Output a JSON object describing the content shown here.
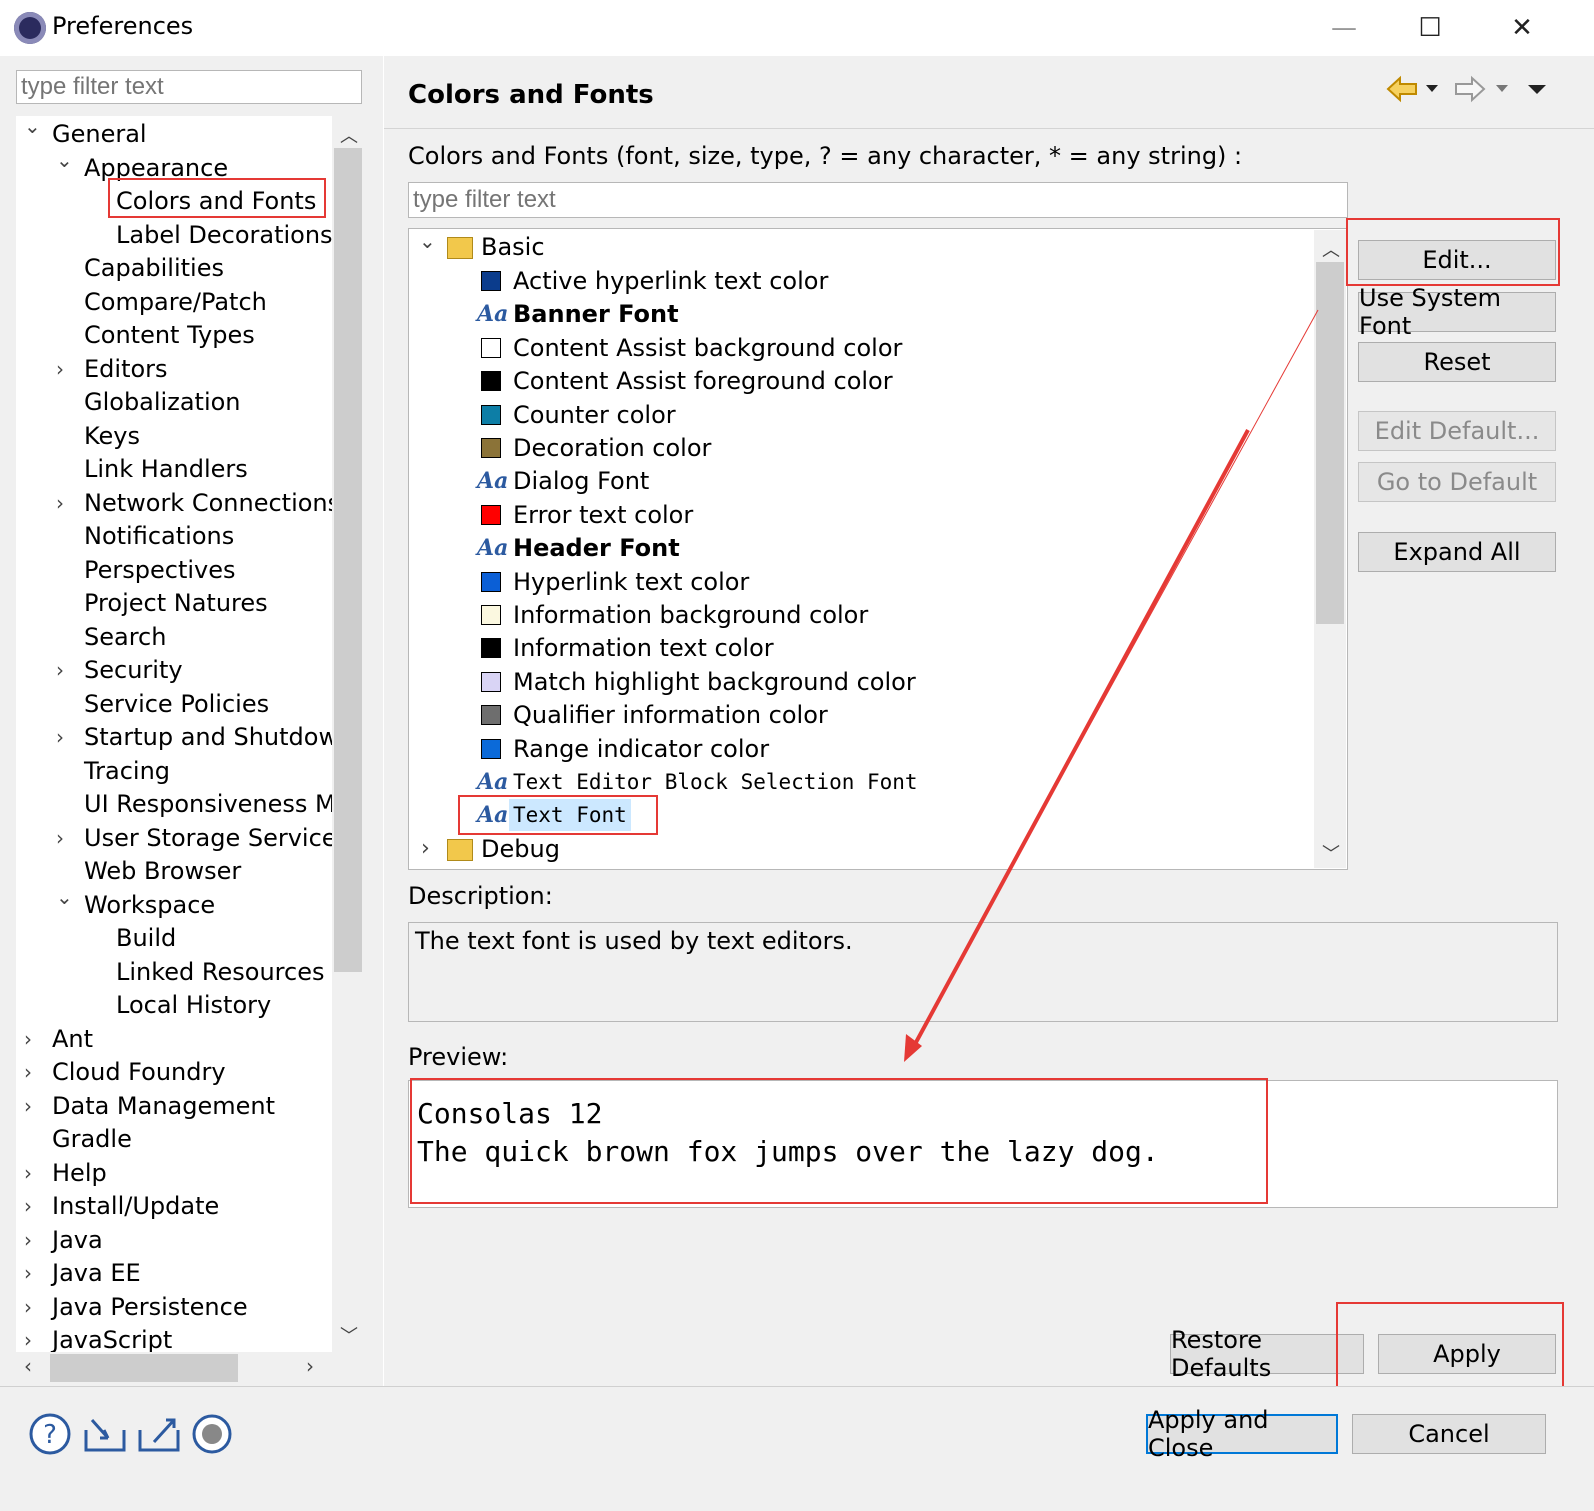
{
  "window": {
    "title": "Preferences",
    "minimize": "—",
    "maximize": "☐",
    "close": "✕"
  },
  "left": {
    "filter_placeholder": "type filter text",
    "tree": [
      {
        "label": "General",
        "indent": 0,
        "arrow": "down"
      },
      {
        "label": "Appearance",
        "indent": 1,
        "arrow": "down"
      },
      {
        "label": "Colors and Fonts",
        "indent": 2,
        "arrow": ""
      },
      {
        "label": "Label Decorations",
        "indent": 2,
        "arrow": ""
      },
      {
        "label": "Capabilities",
        "indent": 1,
        "arrow": ""
      },
      {
        "label": "Compare/Patch",
        "indent": 1,
        "arrow": ""
      },
      {
        "label": "Content Types",
        "indent": 1,
        "arrow": ""
      },
      {
        "label": "Editors",
        "indent": 1,
        "arrow": "right"
      },
      {
        "label": "Globalization",
        "indent": 1,
        "arrow": ""
      },
      {
        "label": "Keys",
        "indent": 1,
        "arrow": ""
      },
      {
        "label": "Link Handlers",
        "indent": 1,
        "arrow": ""
      },
      {
        "label": "Network Connections",
        "indent": 1,
        "arrow": "right"
      },
      {
        "label": "Notifications",
        "indent": 1,
        "arrow": ""
      },
      {
        "label": "Perspectives",
        "indent": 1,
        "arrow": ""
      },
      {
        "label": "Project Natures",
        "indent": 1,
        "arrow": ""
      },
      {
        "label": "Search",
        "indent": 1,
        "arrow": ""
      },
      {
        "label": "Security",
        "indent": 1,
        "arrow": "right"
      },
      {
        "label": "Service Policies",
        "indent": 1,
        "arrow": ""
      },
      {
        "label": "Startup and Shutdown",
        "indent": 1,
        "arrow": "right"
      },
      {
        "label": "Tracing",
        "indent": 1,
        "arrow": ""
      },
      {
        "label": "UI Responsiveness Mc",
        "indent": 1,
        "arrow": ""
      },
      {
        "label": "User Storage Service",
        "indent": 1,
        "arrow": "right"
      },
      {
        "label": "Web Browser",
        "indent": 1,
        "arrow": ""
      },
      {
        "label": "Workspace",
        "indent": 1,
        "arrow": "down"
      },
      {
        "label": "Build",
        "indent": 2,
        "arrow": ""
      },
      {
        "label": "Linked Resources",
        "indent": 2,
        "arrow": ""
      },
      {
        "label": "Local History",
        "indent": 2,
        "arrow": ""
      },
      {
        "label": "Ant",
        "indent": 0,
        "arrow": "right"
      },
      {
        "label": "Cloud Foundry",
        "indent": 0,
        "arrow": "right"
      },
      {
        "label": "Data Management",
        "indent": 0,
        "arrow": "right"
      },
      {
        "label": "Gradle",
        "indent": 0,
        "arrow": ""
      },
      {
        "label": "Help",
        "indent": 0,
        "arrow": "right"
      },
      {
        "label": "Install/Update",
        "indent": 0,
        "arrow": "right"
      },
      {
        "label": "Java",
        "indent": 0,
        "arrow": "right"
      },
      {
        "label": "Java EE",
        "indent": 0,
        "arrow": "right"
      },
      {
        "label": "Java Persistence",
        "indent": 0,
        "arrow": "right"
      },
      {
        "label": "JavaScript",
        "indent": 0,
        "arrow": "right"
      }
    ]
  },
  "main": {
    "title": "Colors and Fonts",
    "filter_label": "Colors and Fonts (font, size, type, ? = any character, * = any string) :",
    "filter_placeholder": "type filter text",
    "groups": {
      "basic": "Basic",
      "debug": "Debug"
    },
    "items": [
      {
        "type": "color",
        "label": "Active hyperlink text color",
        "color": "#0b3c8c"
      },
      {
        "type": "font",
        "label": "Banner Font",
        "bold": true
      },
      {
        "type": "color",
        "label": "Content Assist background color",
        "color": "#ffffff"
      },
      {
        "type": "color",
        "label": "Content Assist foreground color",
        "color": "#000000"
      },
      {
        "type": "color",
        "label": "Counter color",
        "color": "#0d7ea6"
      },
      {
        "type": "color",
        "label": "Decoration color",
        "color": "#8b7338"
      },
      {
        "type": "font",
        "label": "Dialog Font"
      },
      {
        "type": "color",
        "label": "Error text color",
        "color": "#ff0000"
      },
      {
        "type": "font",
        "label": "Header Font",
        "bold": true
      },
      {
        "type": "color",
        "label": "Hyperlink text color",
        "color": "#0b5fd6"
      },
      {
        "type": "color",
        "label": "Information background color",
        "color": "#fbf8e0"
      },
      {
        "type": "color",
        "label": "Information text color",
        "color": "#000000"
      },
      {
        "type": "color",
        "label": "Match highlight background color",
        "color": "#d9d4f5"
      },
      {
        "type": "color",
        "label": "Qualifier information color",
        "color": "#6e6e6e"
      },
      {
        "type": "color",
        "label": "Range indicator color",
        "color": "#0b6ad9"
      },
      {
        "type": "font",
        "label": "Text Editor Block Selection Font",
        "mono": true
      },
      {
        "type": "font",
        "label": "Text Font",
        "mono": true,
        "selected": true
      }
    ],
    "buttons": {
      "edit": "Edit...",
      "use_system_font": "Use System Font",
      "reset": "Reset",
      "edit_default": "Edit Default...",
      "go_to_default": "Go to Default",
      "expand_all": "Expand All"
    },
    "description_label": "Description:",
    "description": "The text font is used by text editors.",
    "preview_label": "Preview:",
    "preview_line1": "Consolas 12",
    "preview_line2": "The quick brown fox jumps over the lazy dog.",
    "restore_defaults": "Restore Defaults",
    "apply": "Apply"
  },
  "footer": {
    "apply_and_close": "Apply and Close",
    "cancel": "Cancel"
  },
  "colors": {
    "annotation": "#e53935",
    "selection": "#cce8ff",
    "accent": "#0078d7"
  }
}
